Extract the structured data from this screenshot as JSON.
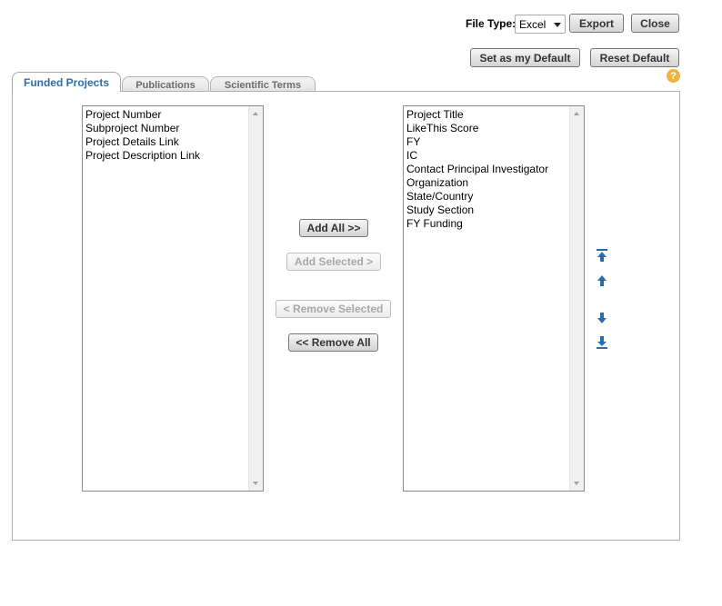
{
  "toolbar": {
    "file_type_label": "File Type:",
    "file_type_value": "Excel",
    "export_label": "Export",
    "close_label": "Close",
    "set_default_label": "Set as my Default",
    "reset_default_label": "Reset Default",
    "help_glyph": "?"
  },
  "tabs": [
    {
      "label": "Funded Projects",
      "active": true
    },
    {
      "label": "Publications",
      "active": false
    },
    {
      "label": "Scientific Terms",
      "active": false
    }
  ],
  "available_fields": [
    "Project Number",
    "Subproject Number",
    "Project Details Link",
    "Project Description Link"
  ],
  "selected_fields": [
    "Project Title",
    "LikeThis Score",
    "FY",
    "IC",
    "Contact Principal Investigator",
    "Organization",
    "State/Country",
    "Study Section",
    "FY Funding"
  ],
  "transfer": {
    "add_all_label": "Add All >>",
    "add_selected_label": "Add Selected >",
    "remove_selected_label": "< Remove Selected",
    "remove_all_label": "<< Remove All"
  },
  "order_icons": [
    "move-top-icon",
    "move-up-icon",
    "move-down-icon",
    "move-bottom-icon"
  ],
  "colors": {
    "active_tab_text": "#2f6ea3",
    "order_arrow": "#2a6ea8",
    "help_icon": "#f0b43a",
    "disabled_text": "#a8a8a8"
  }
}
